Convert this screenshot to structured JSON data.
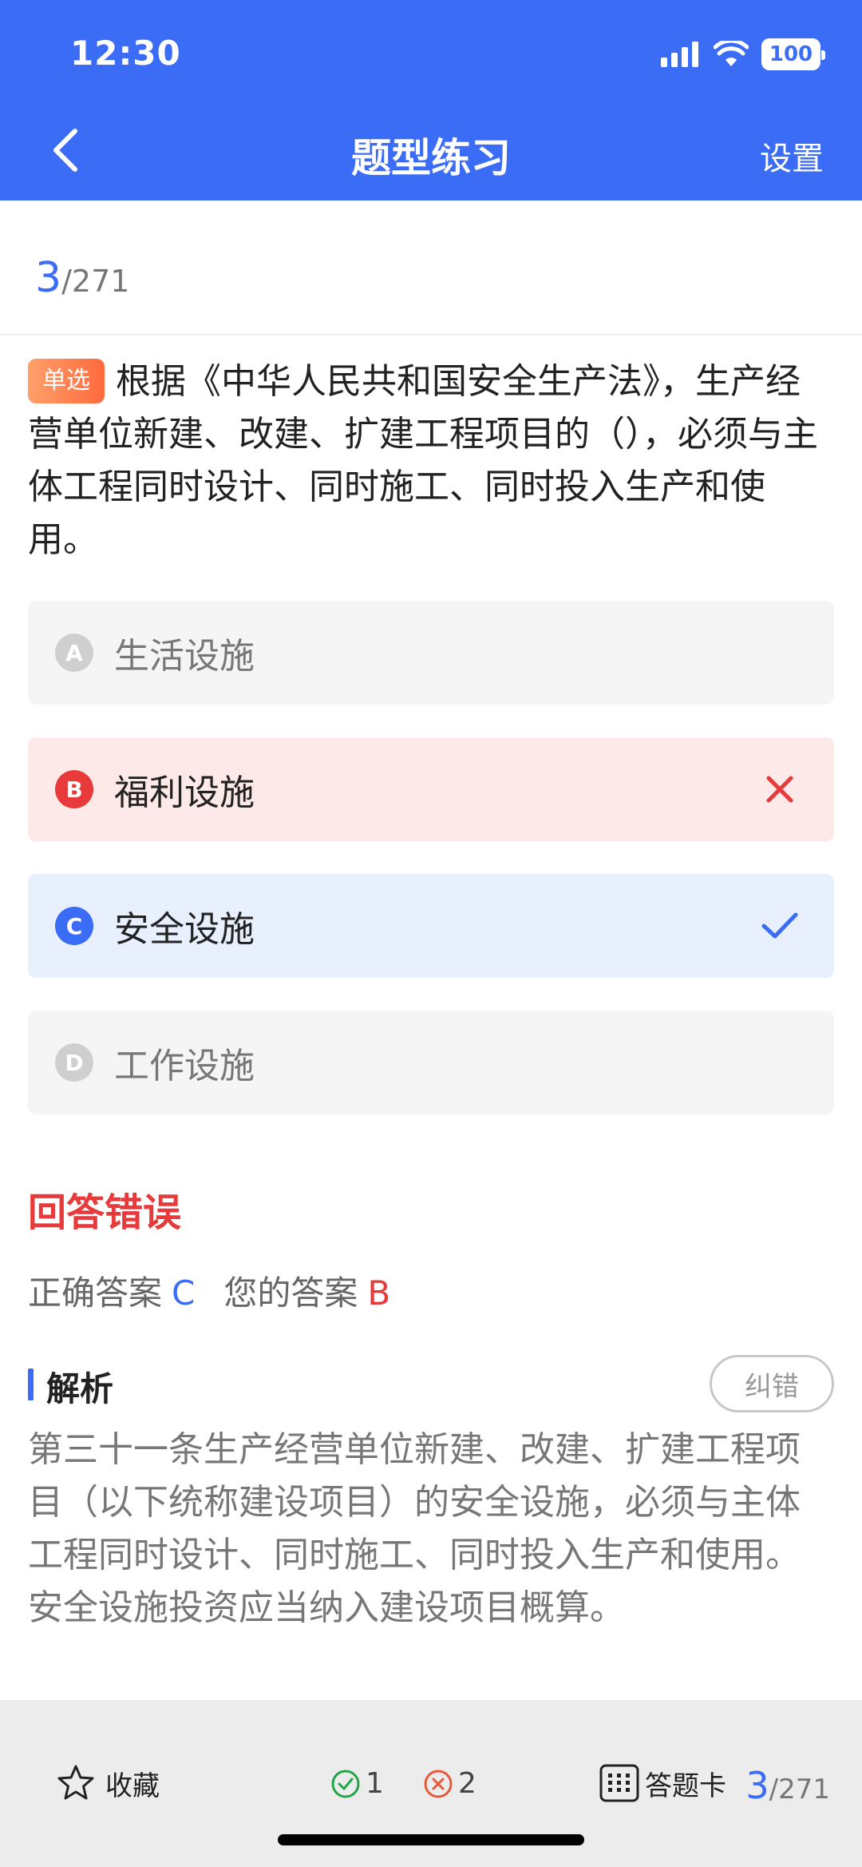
{
  "status": {
    "time": "12:30",
    "battery": "100"
  },
  "nav": {
    "title": "题型练习",
    "settings_label": "设置"
  },
  "progress": {
    "current": "3",
    "total": "/271"
  },
  "question": {
    "type_badge": "单选",
    "text": "根据《中华人民共和国安全生产法》，生产经营单位新建、改建、扩建工程项目的（），必须与主体工程同时设计、同时施工、同时投入生产和使用。"
  },
  "options": [
    {
      "letter": "A",
      "text": "生活设施",
      "state": "normal"
    },
    {
      "letter": "B",
      "text": "福利设施",
      "state": "wrong"
    },
    {
      "letter": "C",
      "text": "安全设施",
      "state": "correct"
    },
    {
      "letter": "D",
      "text": "工作设施",
      "state": "normal"
    }
  ],
  "result": {
    "title": "回答错误",
    "correct_label": "正确答案",
    "correct_value": "C",
    "user_label": "您的答案",
    "user_value": "B"
  },
  "analysis": {
    "title": "解析",
    "fix_label": "纠错",
    "text": "第三十一条生产经营单位新建、改建、扩建工程项目（以下统称建设项目）的安全设施，必须与主体工程同时设计、同时施工、同时投入生产和使用。安全设施投资应当纳入建设项目概算。"
  },
  "bottom": {
    "favorite_label": "收藏",
    "correct_count": "1",
    "wrong_count": "2",
    "answer_card_label": "答题卡",
    "progress_current": "3",
    "progress_total": "/271"
  },
  "colors": {
    "primary": "#3b6cf6",
    "error": "#e8393b",
    "success": "#22a447"
  }
}
